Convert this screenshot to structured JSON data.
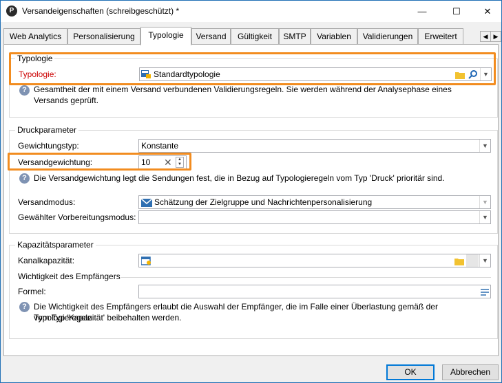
{
  "window": {
    "title": "Versandeigenschaften (schreibgeschützt) *",
    "minimize": "—",
    "maximize": "☐",
    "close": "✕"
  },
  "tabs": [
    {
      "label": "Web Analytics"
    },
    {
      "label": "Personalisierung"
    },
    {
      "label": "Typologie"
    },
    {
      "label": "Versand"
    },
    {
      "label": "Gültigkeit"
    },
    {
      "label": "SMTP"
    },
    {
      "label": "Variablen"
    },
    {
      "label": "Validierungen"
    },
    {
      "label": "Erweitert"
    }
  ],
  "active_tab": "Typologie",
  "typology_group": {
    "title": "Typologie",
    "field_label": "Typologie:",
    "value": "Standardtypologie",
    "info": "Gesamtheit der mit einem Versand verbundenen Validierungsregeln. Sie werden während der Analysephase eines Versands geprüft."
  },
  "print_group": {
    "title": "Druckparameter",
    "weight_type_label": "Gewichtungstyp:",
    "weight_type_value": "Konstante",
    "weight_label": "Versandgewichtung:",
    "weight_value": "10",
    "weight_info": "Die Versandgewichtung legt die Sendungen fest, die in Bezug auf Typologieregeln vom Typ 'Druck' prioritär sind.",
    "mode_label": "Versandmodus:",
    "mode_value": "Schätzung der Zielgruppe und Nachrichtenpersonalisierung",
    "prep_label": "Gewählter Vorbereitungsmodus:",
    "prep_value": ""
  },
  "capacity_group": {
    "title": "Kapazitätsparameter",
    "channel_label": "Kanalkapazität:",
    "channel_value": "",
    "importance_title": "Wichtigkeit des Empfängers",
    "formula_label": "Formel:",
    "formula_value": "",
    "info_line1": "Die Wichtigkeit des Empfängers erlaubt die Auswahl der Empfänger, die im Falle einer Überlastung gemäß der Typologieregeln",
    "info_line2": "vom  Typ 'Kapazität' beibehalten werden."
  },
  "buttons": {
    "ok": "OK",
    "cancel": "Abbrechen"
  },
  "colors": {
    "highlight": "#f28c1f",
    "required_label": "#cc0000",
    "focus_border": "#0078d7"
  }
}
